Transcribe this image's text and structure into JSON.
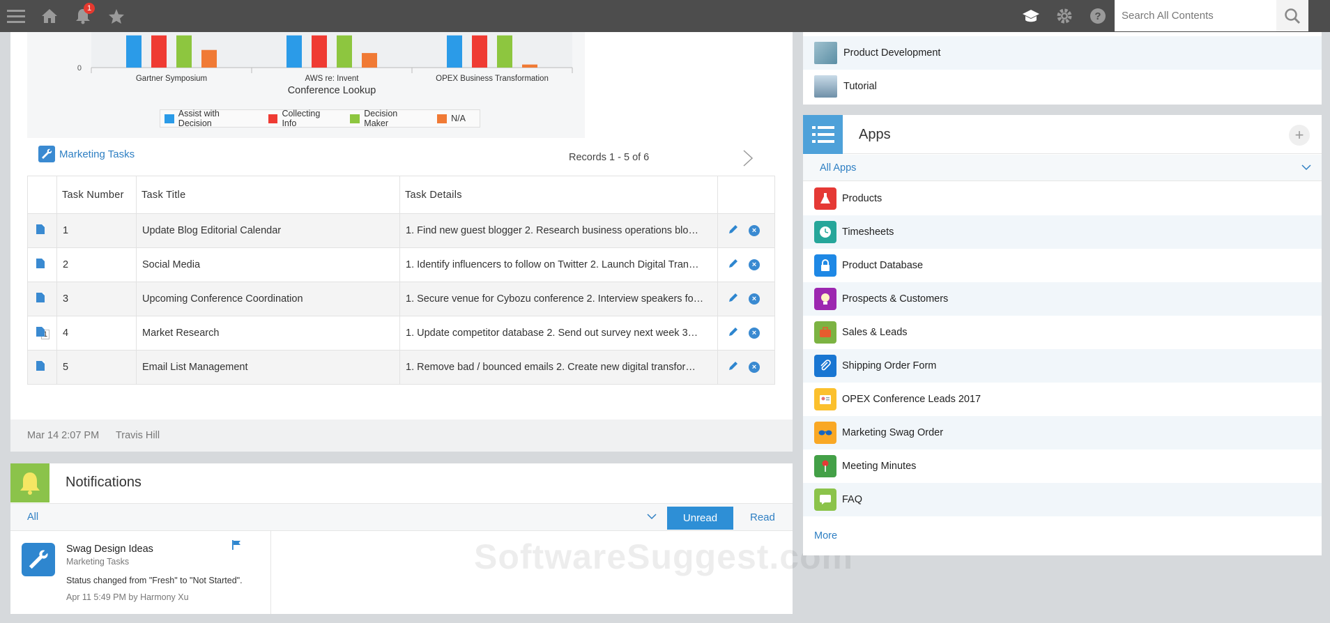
{
  "topbar": {
    "notification_count": "1",
    "search_placeholder": "Search All Contents",
    "bg_color": "#4d4d4d",
    "icons": [
      "menu-icon",
      "home-icon",
      "bell-icon",
      "star-icon",
      "graduation-cap-icon",
      "gear-icon",
      "help-icon",
      "search-icon"
    ]
  },
  "chart_data": {
    "type": "bar",
    "title": "",
    "xlabel": "Conference Lookup",
    "ylabel": "",
    "y_tick_labels": [
      "0"
    ],
    "categories": [
      "Gartner Symposium",
      "AWS re: Invent",
      "OPEX Business Transformation"
    ],
    "series": [
      {
        "name": "Assist with Decision",
        "color": "#2b9be8",
        "values": [
          4.2,
          4.2,
          4.2
        ]
      },
      {
        "name": "Collecting Info",
        "color": "#ef3b33",
        "values": [
          4.2,
          4.2,
          4.2
        ]
      },
      {
        "name": "Decision Maker",
        "color": "#8dc63f",
        "values": [
          4.2,
          4.2,
          4.2
        ]
      },
      {
        "name": "N/A",
        "color": "#f07a35",
        "values": [
          2.3,
          1.9,
          0.4
        ]
      }
    ]
  },
  "tasks": {
    "app_link": "Marketing Tasks",
    "records_text": "Records 1 - 5  of 6",
    "columns": [
      "",
      "Task Number",
      "Task Title",
      "Task Details",
      ""
    ],
    "rows": [
      {
        "number": "1",
        "title": "Update Blog Editorial Calendar",
        "details": "1. Find new guest blogger  2. Research business operations blo…",
        "attachments": ""
      },
      {
        "number": "2",
        "title": "Social Media",
        "details": "1. Identify influencers to follow on Twitter 2. Launch Digital Tran…",
        "attachments": ""
      },
      {
        "number": "3",
        "title": "Upcoming Conference Coordination",
        "details": "1. Secure venue for Cybozu conference 2. Interview speakers fo…",
        "attachments": ""
      },
      {
        "number": "4",
        "title": "Market Research",
        "details": "1. Update competitor database 2. Send out survey next week 3…",
        "attachments": "1"
      },
      {
        "number": "5",
        "title": "Email List Management",
        "details": "1. Remove bad / bounced emails 2. Create new digital transfor…",
        "attachments": ""
      }
    ]
  },
  "post_footer": {
    "timestamp": "Mar 14 2:07 PM",
    "author": "Travis Hill"
  },
  "notifications": {
    "title": "Notifications",
    "filter_label": "All",
    "unread_label": "Unread",
    "read_label": "Read",
    "item": {
      "title": "Swag Design Ideas",
      "app": "Marketing Tasks",
      "message": "Status changed from \"Fresh\" to \"Not Started\".",
      "meta": "Apr 11 5:49 PM  by Harmony Xu"
    }
  },
  "spaces": [
    {
      "label": "Product Development"
    },
    {
      "label": "Tutorial"
    }
  ],
  "apps": {
    "title": "Apps",
    "filter_label": "All Apps",
    "more_label": "More",
    "items": [
      {
        "label": "Products",
        "color": "#e53935"
      },
      {
        "label": "Timesheets",
        "color": "#26a69a"
      },
      {
        "label": "Product Database",
        "color": "#1e88e5"
      },
      {
        "label": "Prospects & Customers",
        "color": "#9c27b0"
      },
      {
        "label": "Sales & Leads",
        "color": "#7cb342"
      },
      {
        "label": "Shipping Order Form",
        "color": "#1976d2"
      },
      {
        "label": "OPEX Conference Leads 2017",
        "color": "#fbc02d"
      },
      {
        "label": "Marketing Swag Order",
        "color": "#f9a825"
      },
      {
        "label": "Meeting Minutes",
        "color": "#43a047"
      },
      {
        "label": "FAQ",
        "color": "#8bc34a"
      }
    ]
  },
  "watermark": "SoftwareSuggest.com"
}
